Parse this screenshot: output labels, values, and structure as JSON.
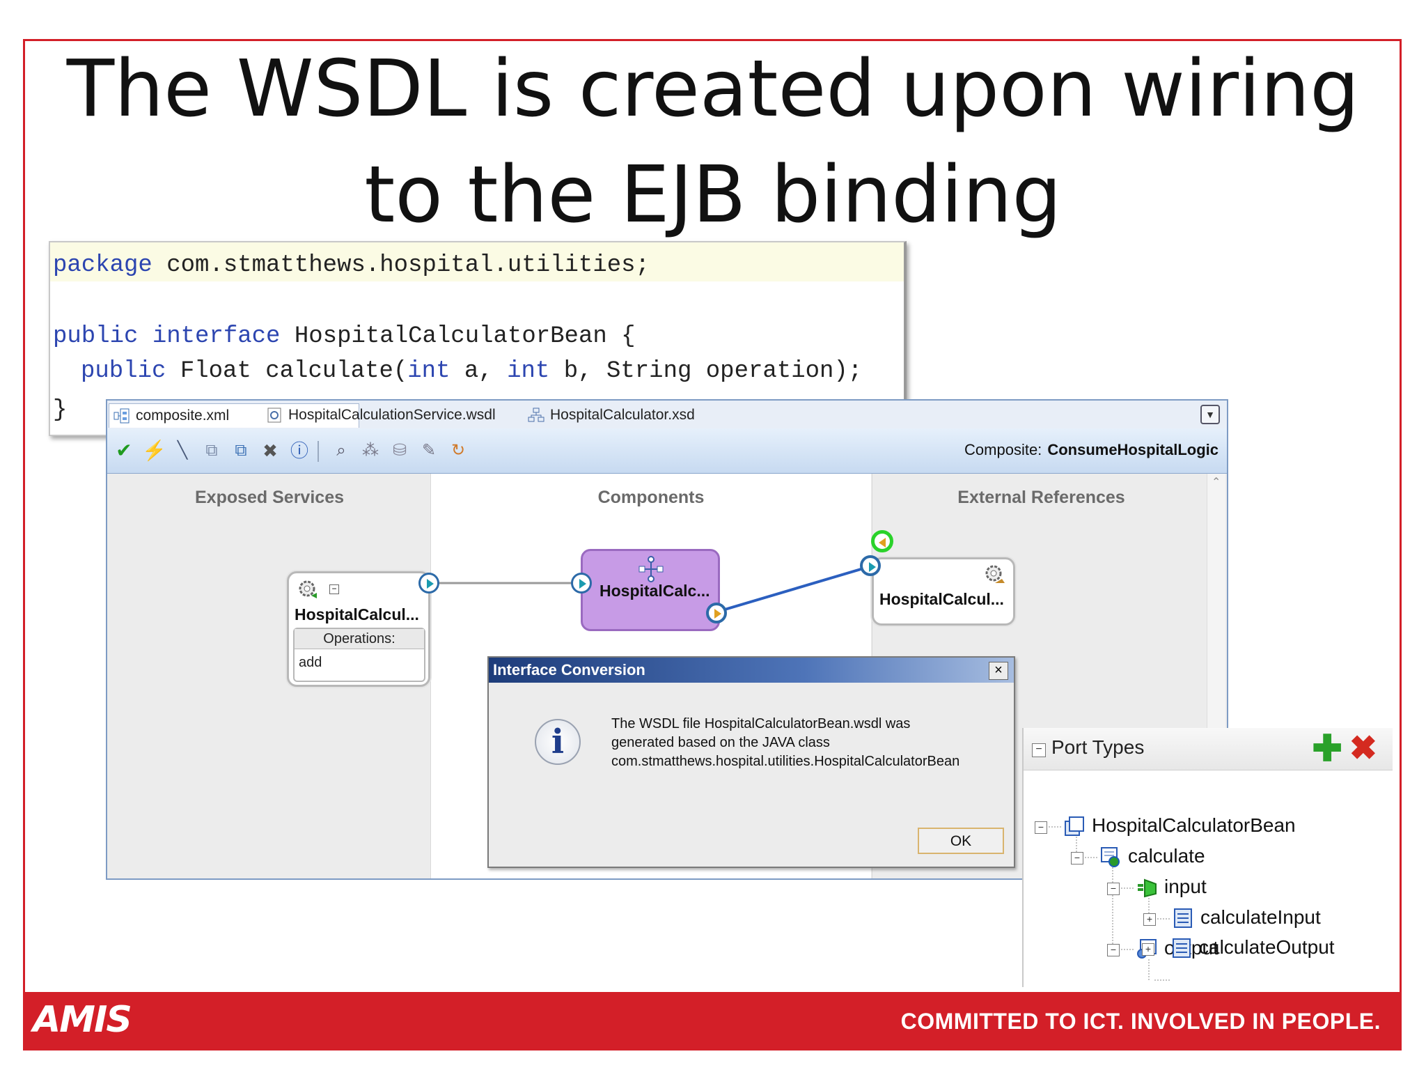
{
  "slide": {
    "title_line1": "The WSDL is created upon wiring",
    "title_line2": "to the EJB binding"
  },
  "code": {
    "line1_kw": "package",
    "line1_rest": " com.stmatthews.hospital.utilities;",
    "line2_kw1": "public",
    "line2_kw2": "interface",
    "line2_rest": " HospitalCalculatorBean {",
    "line3_kw1": "public",
    "line3_mid1": " Float calculate(",
    "line3_kw2": "int",
    "line3_mid2": " a, ",
    "line3_kw3": "int",
    "line3_rest": " b, String operation);",
    "line4": "}"
  },
  "ide": {
    "tabs": [
      {
        "label": "composite.xml",
        "active": true
      },
      {
        "label": "HospitalCalculationService.wsdl",
        "active": false
      },
      {
        "label": "HospitalCalculator.xsd",
        "active": false
      }
    ],
    "composite_label": "Composite:",
    "composite_name": "ConsumeHospitalLogic",
    "lanes": {
      "exposed": "Exposed Services",
      "components": "Components",
      "external": "External References"
    },
    "service": {
      "name": "HospitalCalcul...",
      "operations_label": "Operations:",
      "operation": "add"
    },
    "component": {
      "name": "HospitalCalc..."
    },
    "reference": {
      "name": "HospitalCalcul..."
    }
  },
  "dialog": {
    "title": "Interface Conversion",
    "close": "×",
    "icon": "i",
    "message_line1": "The WSDL file HospitalCalculatorBean.wsdl was",
    "message_line2": "generated based on the JAVA class",
    "message_line3": "com.stmatthews.hospital.utilities.HospitalCalculatorBean",
    "ok": "OK"
  },
  "port_types": {
    "header": "Port Types",
    "add": "✚",
    "delete": "✖",
    "tree": {
      "root": "HospitalCalculatorBean",
      "operation": "calculate",
      "input": "input",
      "input_msg": "calculateInput",
      "output": "output",
      "output_msg": "calculateOutput"
    }
  },
  "footer": {
    "logo": "AMIS",
    "tagline": "COMMITTED TO ICT.  INVOLVED IN PEOPLE."
  },
  "colors": {
    "brand_red": "#d31f28",
    "component_purple": "#c79be6",
    "wire_blue": "#2b5fbf"
  }
}
